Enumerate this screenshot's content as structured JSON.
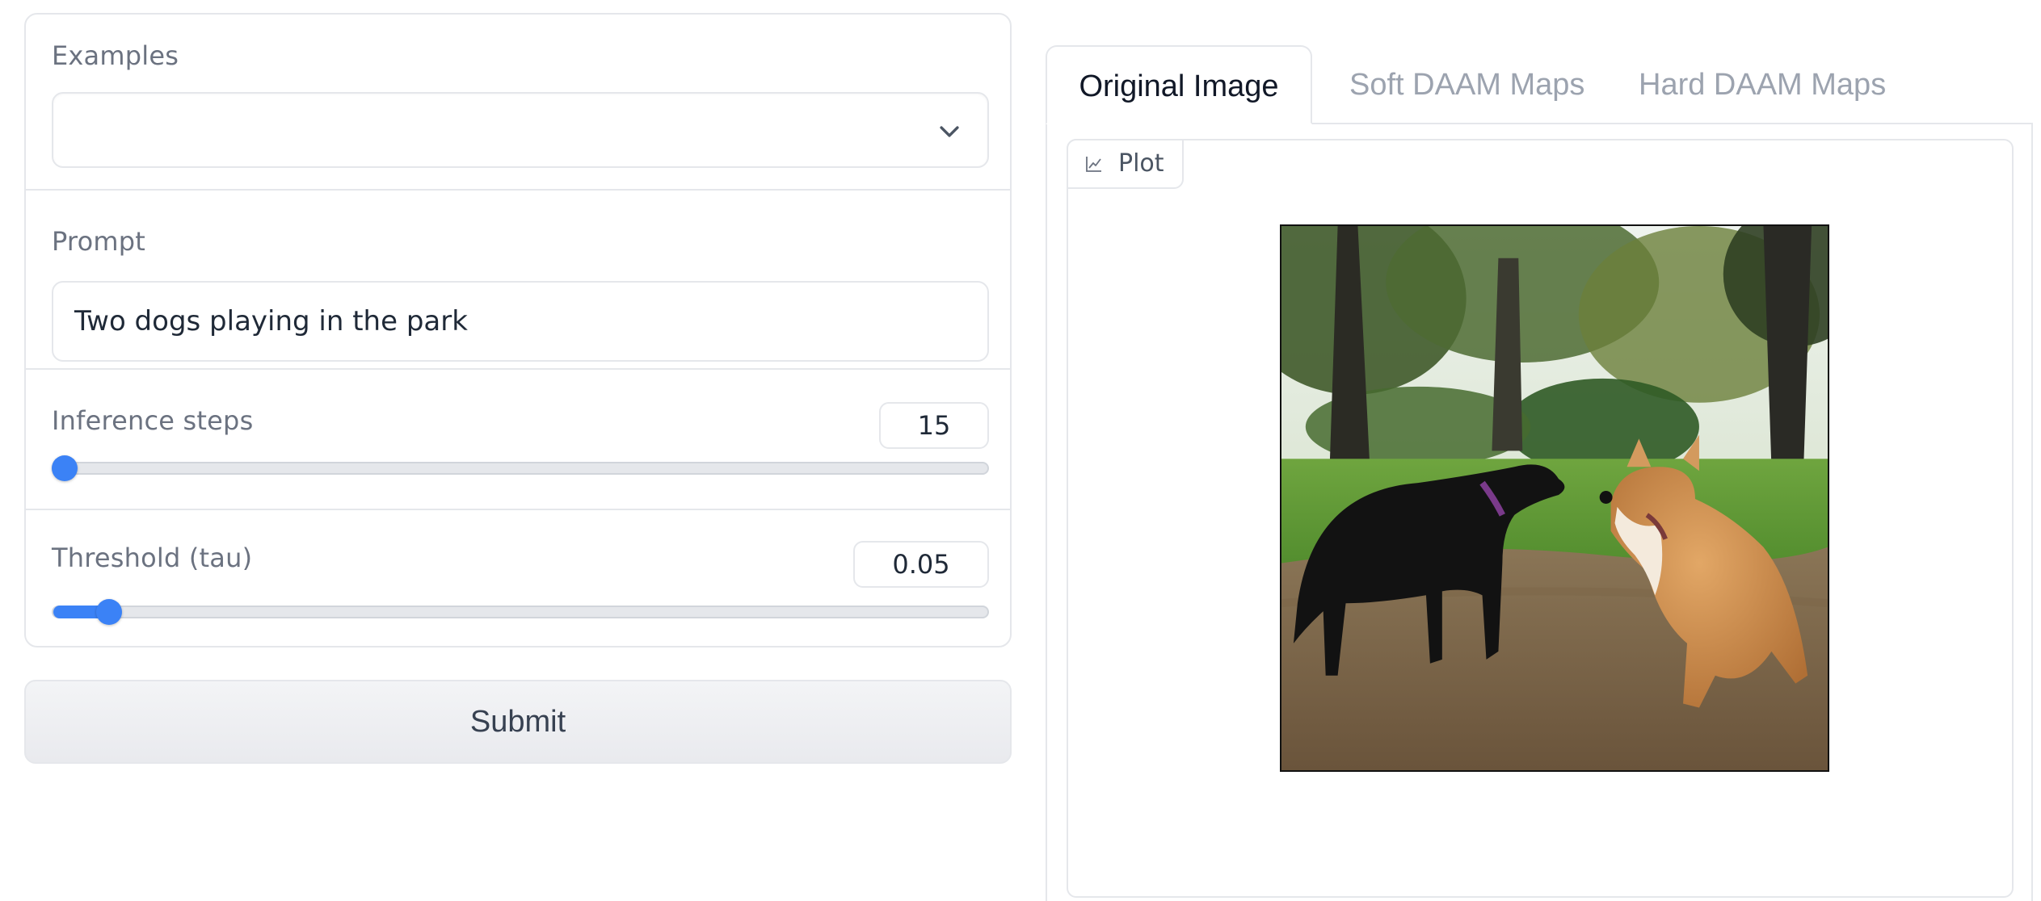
{
  "form": {
    "examples": {
      "label": "Examples",
      "selected": ""
    },
    "prompt": {
      "label": "Prompt",
      "value": "Two dogs playing in the park"
    },
    "inference_steps": {
      "label": "Inference steps",
      "value": "15",
      "fraction": 0.0
    },
    "threshold": {
      "label": "Threshold (tau)",
      "value": "0.05",
      "fraction": 0.06
    },
    "submit_label": "Submit"
  },
  "output": {
    "tabs": [
      {
        "label": "Original Image",
        "active": true
      },
      {
        "label": "Soft DAAM Maps",
        "active": false
      },
      {
        "label": "Hard DAAM Maps",
        "active": false
      }
    ],
    "plot_label": "Plot",
    "plot_icon": "chart-icon"
  },
  "colors": {
    "accent": "#3b82f6",
    "border": "#e5e7eb",
    "label_text": "#6b7280"
  }
}
